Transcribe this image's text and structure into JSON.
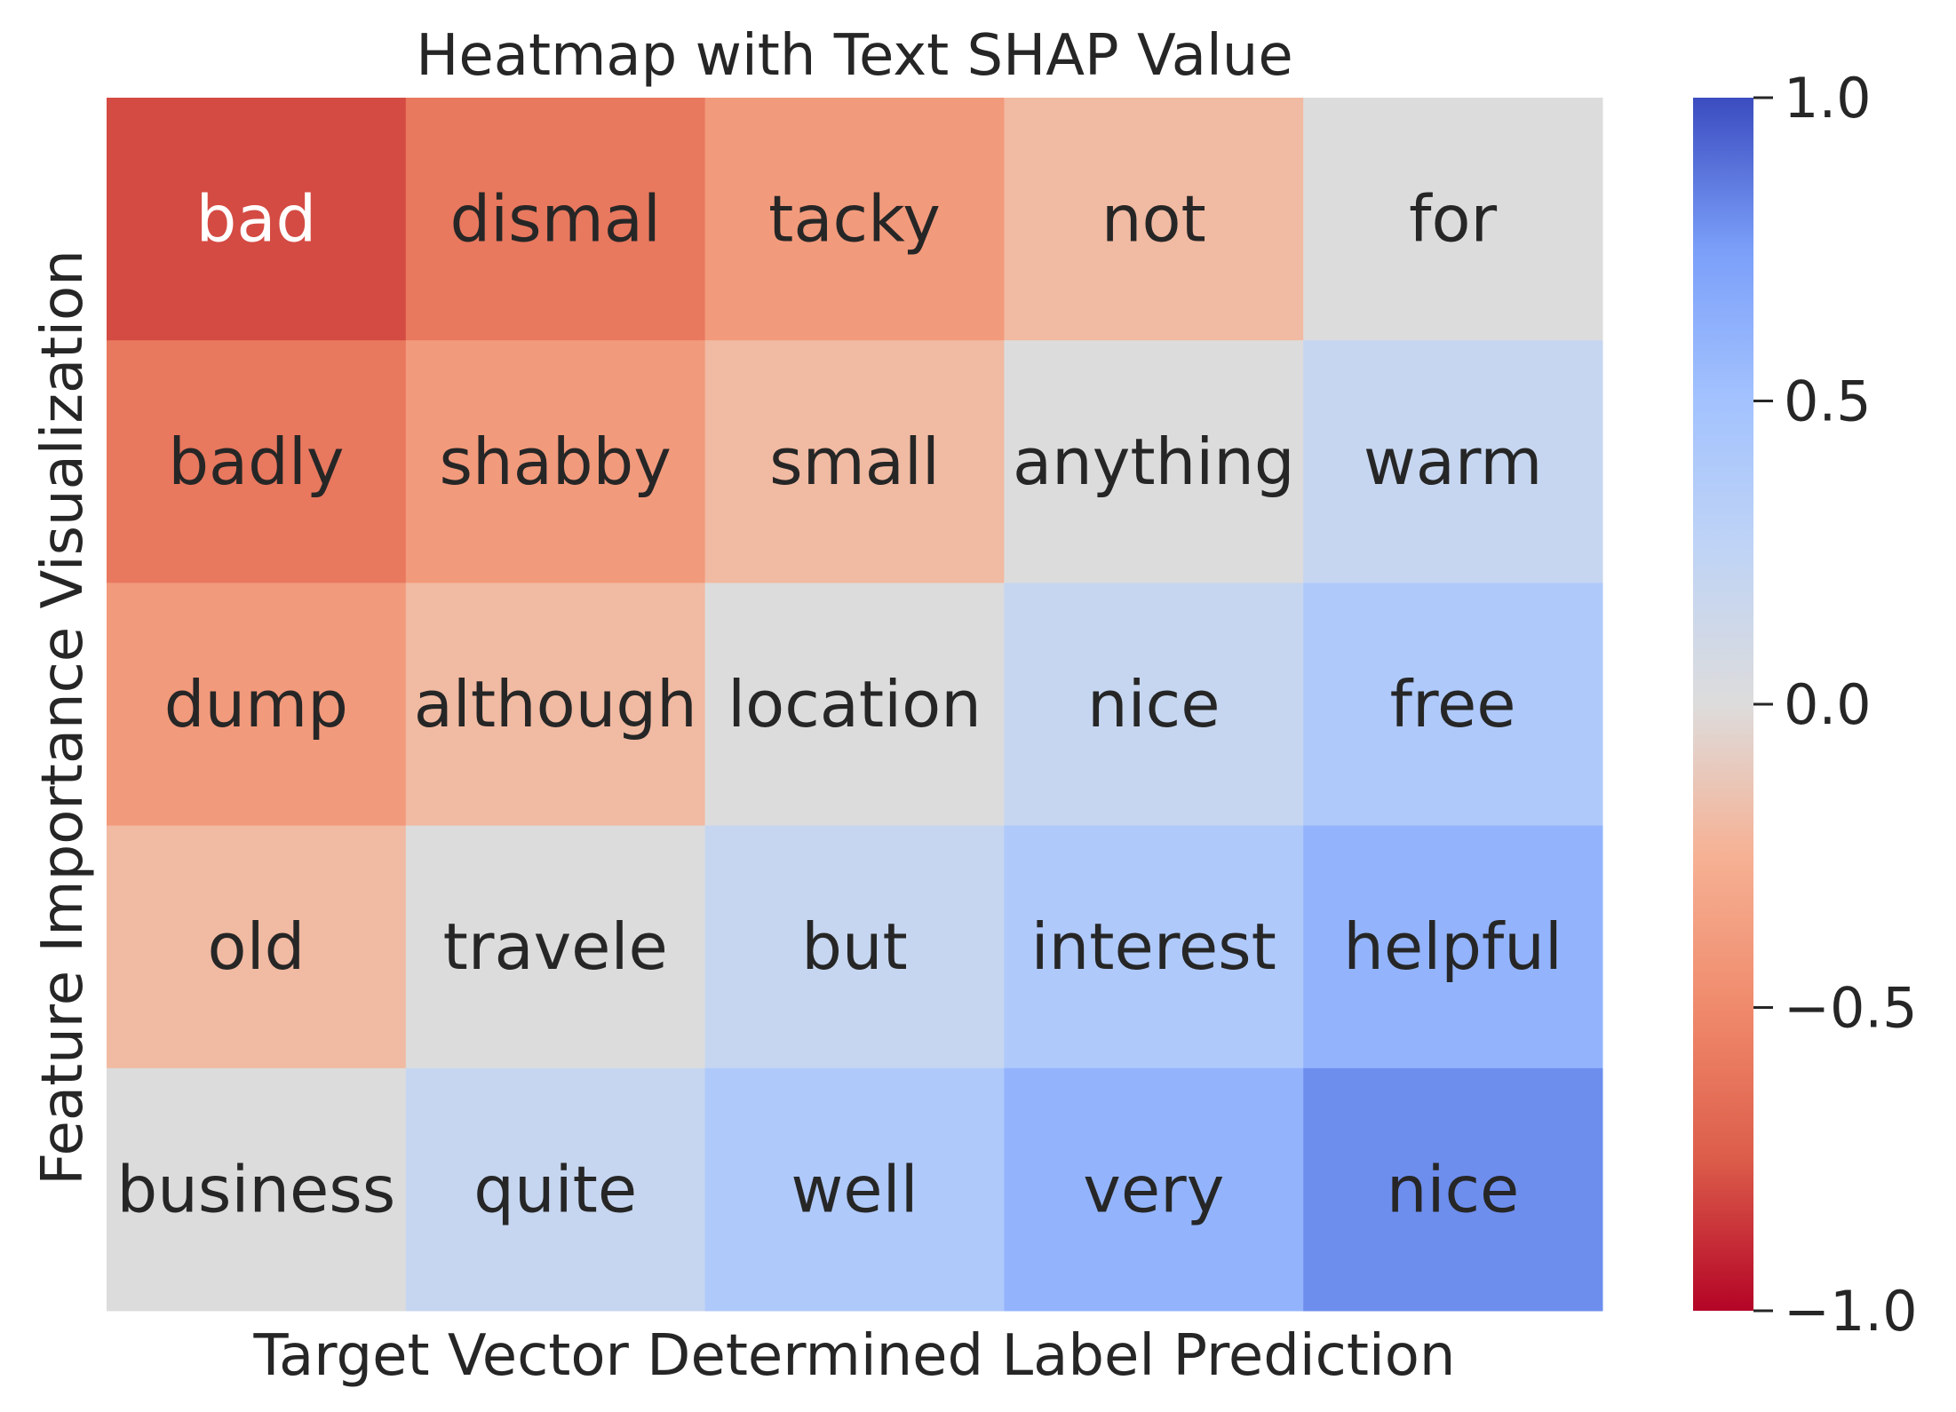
{
  "chart_data": {
    "type": "heatmap",
    "title": "Heatmap with Text SHAP Value",
    "xlabel": "Target Vector Determined Label Prediction",
    "ylabel": "Feature Importance Visualization",
    "colormap": "coolwarm_r",
    "vmin": -1.0,
    "vmax": 1.0,
    "colorbar_ticks": [
      1.0,
      0.5,
      0.0,
      -0.5,
      -1.0
    ],
    "colorbar_tick_labels": [
      "1.0",
      "0.5",
      "0.0",
      "−0.5",
      "−1.0"
    ],
    "grid": false,
    "rows": 5,
    "cols": 5,
    "values": [
      [
        -0.8,
        -0.6,
        -0.4,
        -0.2,
        0.0
      ],
      [
        -0.6,
        -0.4,
        -0.2,
        0.0,
        0.2
      ],
      [
        -0.4,
        -0.2,
        0.0,
        0.2,
        0.4
      ],
      [
        -0.2,
        0.0,
        0.2,
        0.4,
        0.6
      ],
      [
        0.0,
        0.2,
        0.4,
        0.6,
        0.8
      ]
    ],
    "annotations": [
      [
        "bad",
        "dismal",
        "tacky",
        "not",
        "for"
      ],
      [
        "badly",
        "shabby",
        "small",
        "anything",
        "warm"
      ],
      [
        "dump",
        "although",
        "location",
        "nice",
        "free"
      ],
      [
        "old",
        "travele",
        "but",
        "interest",
        "helpful"
      ],
      [
        "business",
        "quite",
        "well",
        "very",
        "nice"
      ]
    ]
  }
}
